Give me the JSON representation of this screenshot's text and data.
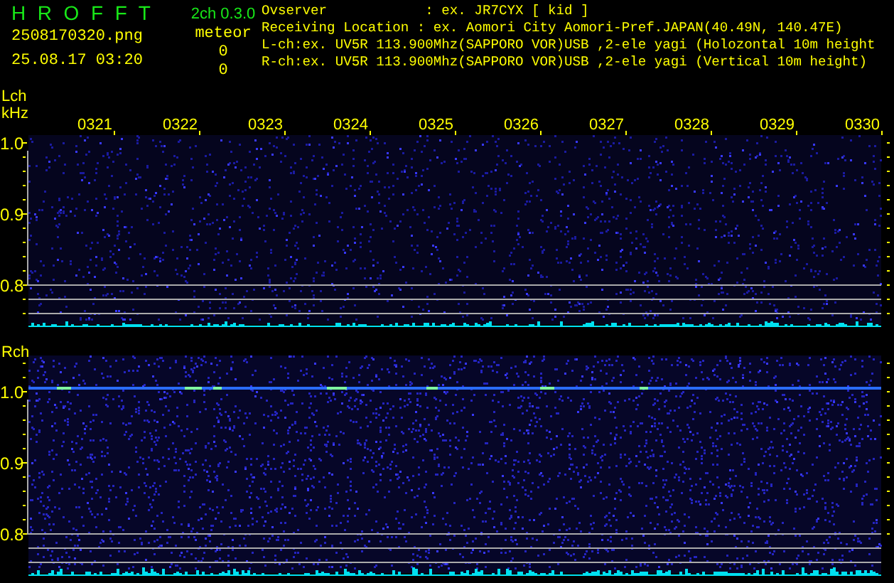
{
  "app": {
    "logo": "H R O F F T",
    "version": "2ch 0.3.0",
    "mode": "meteor"
  },
  "file": {
    "name": "2508170320.png",
    "datetime": "25.08.17 03:20"
  },
  "counts": [
    "0",
    "0"
  ],
  "info_lines": [
    "Ovserver            : ex. JR7CYX [ kid ]",
    "Receiving Location : ex. Aomori City Aomori-Pref.JAPAN(40.49N, 140.47E)",
    "L-ch:ex. UV5R 113.900Mhz(SAPPORO VOR)USB ,2-ele yagi (Holozontal 10m height",
    "R-ch:ex. UV5R 113.900Mhz(SAPPORO VOR)USB ,2-ele yagi (Vertical 10m height)"
  ],
  "panels": [
    {
      "channel": "Lch",
      "unit": "kHz",
      "time_labels": [
        "0321",
        "0322",
        "0323",
        "0324",
        "0325",
        "0326",
        "0327",
        "0328",
        "0329",
        "0330"
      ],
      "y_labels": [
        "1.0",
        "0.9",
        "0.8"
      ]
    },
    {
      "channel": "Rch",
      "y_labels": [
        "1.0",
        "0.9",
        "0.8"
      ]
    }
  ]
}
